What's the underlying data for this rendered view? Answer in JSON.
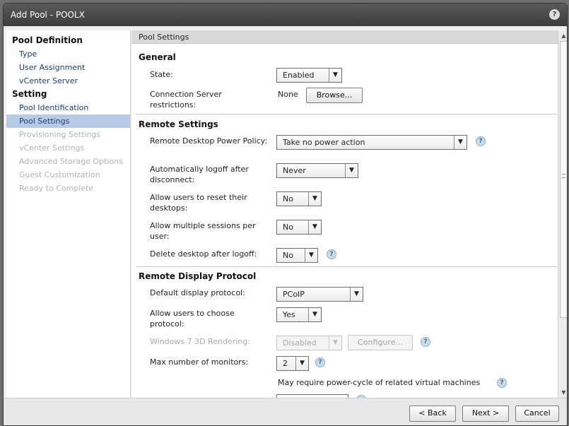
{
  "window": {
    "title": "Add Pool - POOLX",
    "help_label": "?"
  },
  "sidebar": {
    "sections": [
      {
        "title": "Pool Definition",
        "items": [
          {
            "label": "Type",
            "state": "link"
          },
          {
            "label": "User Assignment",
            "state": "link"
          },
          {
            "label": "vCenter Server",
            "state": "link"
          }
        ]
      },
      {
        "title": "Setting",
        "items": [
          {
            "label": "Pool Identification",
            "state": "link"
          },
          {
            "label": "Pool Settings",
            "state": "active"
          },
          {
            "label": "Provisioning Settings",
            "state": "disabled"
          },
          {
            "label": "vCenter Settings",
            "state": "disabled"
          },
          {
            "label": "Advanced Storage Options",
            "state": "disabled"
          },
          {
            "label": "Guest Customization",
            "state": "disabled"
          },
          {
            "label": "Ready to Complete",
            "state": "disabled"
          }
        ]
      }
    ]
  },
  "panel": {
    "header": "Pool Settings",
    "general": {
      "title": "General",
      "state_label": "State:",
      "state_value": "Enabled",
      "conn_label": "Connection Server restrictions:",
      "conn_value": "None",
      "browse_label": "Browse..."
    },
    "remote": {
      "title": "Remote Settings",
      "power_label": "Remote Desktop Power Policy:",
      "power_value": "Take no power action",
      "logoff_label": "Automatically logoff after disconnect:",
      "logoff_value": "Never",
      "reset_label": "Allow users to reset their desktops:",
      "reset_value": "No",
      "multi_label": "Allow multiple sessions per user:",
      "multi_value": "No",
      "delete_label": "Delete desktop after logoff:",
      "delete_value": "No"
    },
    "display": {
      "title": "Remote Display Protocol",
      "default_label": "Default display protocol:",
      "default_value": "PCoIP",
      "choose_label": "Allow users to choose protocol:",
      "choose_value": "Yes",
      "render_label": "Windows 7 3D Rendering:",
      "render_value": "Disabled",
      "configure_label": "Configure...",
      "monitors_label": "Max number of monitors:",
      "monitors_value": "2",
      "power_cycle_note": "May require power-cycle of related virtual machines"
    },
    "help_glyph": "?"
  },
  "footer": {
    "back_label": "< Back",
    "next_label": "Next >",
    "cancel_label": "Cancel"
  },
  "colors": {
    "active_nav": "#b7cbe6",
    "link": "#1b3d78",
    "titlebar": "#3c3c3c"
  }
}
